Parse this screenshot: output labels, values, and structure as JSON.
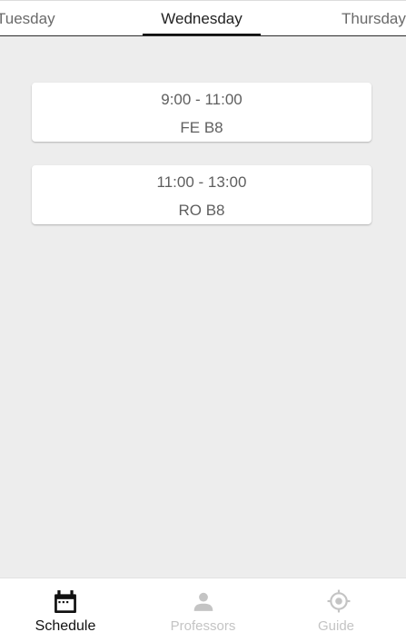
{
  "tabs": {
    "prev": "Tuesday",
    "current": "Wednesday",
    "next": "Thursday"
  },
  "classes": [
    {
      "time": "9:00 - 11:00",
      "room": "FE B8"
    },
    {
      "time": "11:00 - 13:00",
      "room": "RO B8"
    }
  ],
  "bottom_nav": {
    "items": [
      {
        "label": "Schedule",
        "icon": "calendar-icon",
        "active": true
      },
      {
        "label": "Professors",
        "icon": "person-icon",
        "active": false
      },
      {
        "label": "Guide",
        "icon": "target-icon",
        "active": false
      }
    ]
  },
  "colors": {
    "background": "#ededed",
    "active": "#111111",
    "inactive": "#c4c4c4",
    "card_text": "#5f5f5f"
  }
}
